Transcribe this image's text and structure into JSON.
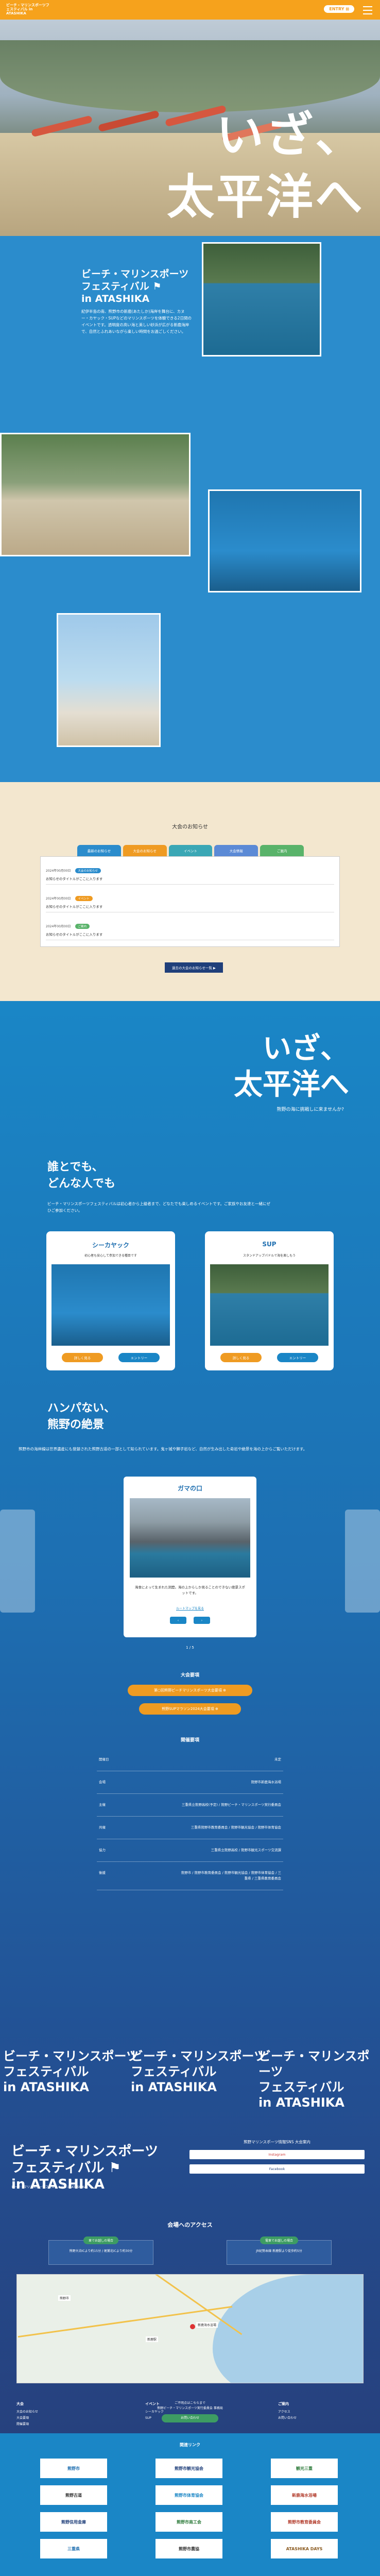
{
  "header": {
    "logo_text": "ビーチ・マリンスポーツフェスティバル in ATASHIKA",
    "entry_label": "ENTRY ⊠",
    "brand_color": "#f6a21c"
  },
  "hero": {
    "title_line1": "いざ、",
    "title_line2": "太平洋へ"
  },
  "intro": {
    "title_line1": "ビーチ・マリンスポーツ",
    "title_line2": "フェスティバル",
    "title_line3": "in ATASHIKA",
    "body": "紀伊半島の南、熊野市の新鹿(あたしか)海岸を舞台に、カヌー・カヤック・SUPなどのマリンスポーツを体験できる2日間のイベントです。透明度の高い海と美しい砂浜が広がる新鹿海岸で、自然とふれあいながら楽しい時間をお過ごしください。"
  },
  "news": {
    "title": "大会のお知らせ",
    "tabs": [
      "最新のお知らせ",
      "大会のお知らせ",
      "イベント",
      "大会情報",
      "ご案内"
    ],
    "tab_colors": [
      "#2b8ccc",
      "#ef9b22",
      "#3aa7b5",
      "#5b8ad6",
      "#59b36a"
    ],
    "items": [
      {
        "date": "2024年00月00日",
        "tag": "大会のお知らせ",
        "tag_color": "#2b8ccc",
        "text": "お知らせのタイトルがここに入ります"
      },
      {
        "date": "2024年00月00日",
        "tag": "イベント",
        "tag_color": "#ef9b22",
        "text": "お知らせのタイトルがここに入ります"
      },
      {
        "date": "2024年00月00日",
        "tag": "ご案内",
        "tag_color": "#59b36a",
        "text": "お知らせのタイトルがここに入ります"
      }
    ],
    "more_label": "過去の大会のお知らせ一覧 ▶"
  },
  "catch": {
    "line1": "いざ、",
    "line2": "太平洋へ",
    "sub": "熊野の海に挑戦しに来ませんか?"
  },
  "everyone": {
    "title_line1": "誰とでも、",
    "title_line2": "どんな人でも",
    "body": "ビーチ・マリンスポーツフェスティバルは初心者から上級者まで、どなたでも楽しめるイベントです。ご家族やお友達と一緒にぜひご参加ください。"
  },
  "cards": [
    {
      "title": "シーカヤック",
      "sub": "初心者も安心して参加できる種目です",
      "btn1": "詳しく見る",
      "btn2": "エントリー"
    },
    {
      "title": "SUP",
      "sub": "スタンドアップパドルで海を楽しもう",
      "btn1": "詳しく見る",
      "btn2": "エントリー"
    }
  ],
  "scenery": {
    "title_line1": "ハンパない、",
    "title_line2": "熊野の絶景",
    "body": "熊野市の海岸線は世界遺産にも登録された熊野古道の一部として知られています。鬼ヶ城や獅子岩など、自然が生み出した奇岩や絶景を海の上からご覧いただけます。"
  },
  "slide": {
    "title": "ガマの口",
    "desc": "海食によって生まれた洞窟。海の上からしか見ることのできない絶景スポットです。",
    "link": "ルートマップを見る",
    "prev": "‹",
    "next": "›",
    "counter": "1 / 5"
  },
  "rules": {
    "title": "大会要項",
    "btn1": "第○回熊野ビーチマリンスポーツ大会要項 ⊕",
    "btn2": "熊野SUPマラソン2024大会要項 ⊕"
  },
  "org": {
    "title": "開催要項",
    "rows": [
      {
        "k": "開催日",
        "v": "未定"
      },
      {
        "k": "会場",
        "v": "熊野市新鹿海水浴場"
      },
      {
        "k": "主催",
        "v": "三重県立熊野高校(予定) / 熊野ビーチ・マリンスポーツ実行委員会"
      },
      {
        "k": "共催",
        "v": "三重県熊野市教育委員会 / 熊野市観光協会 / 熊野市体育協会"
      },
      {
        "k": "協力",
        "v": "三重県立熊野高校 / 熊野市観光スポーツ交流課"
      },
      {
        "k": "後援",
        "v": "熊野市 / 熊野市教育委員会 / 熊野市観光協会 / 熊野市体育協会 / 三重県 / 三重県教育委員会"
      }
    ]
  },
  "marquee": {
    "line1": "ビーチ・マリンスポーツ",
    "line2": "フェスティバル",
    "line3": "in ATASHIKA"
  },
  "footer": {
    "logo_line1": "ビーチ・マリンスポーツ",
    "logo_line2": "フェスティバル",
    "logo_line3": "in ATASHIKA",
    "logo_sub": "ビーチ・マリンスポーツフェスティバル in ATASHIKA",
    "entry_title": "熊野マリンスポーツ情報SNS 大会案内",
    "entry_btn1": "Instagram",
    "entry_btn2": "Facebook",
    "access_title": "会場へのアクセス",
    "access_boxes": [
      {
        "badge": "車でお越しの場合",
        "text": "熊野大泊ICより約15分 / 尾鷲北ICより約30分"
      },
      {
        "badge": "電車でお越しの場合",
        "text": "JR紀勢本線 新鹿駅より徒歩約5分"
      }
    ],
    "map_labels": [
      "新鹿海水浴場",
      "新鹿駅",
      "熊野市"
    ],
    "sitemap": [
      {
        "head": "大会",
        "items": [
          "大会のお知らせ",
          "大会要項",
          "開催要項"
        ]
      },
      {
        "head": "イベント",
        "items": [
          "シーカヤック",
          "SUP"
        ]
      },
      {
        "head": "ご案内",
        "items": [
          "アクセス",
          "お問い合わせ"
        ]
      }
    ],
    "contact_head": "ご不明点はこちらまで",
    "contact_text": "熊野ビーチ・マリンスポーツ実行委員会 事務局",
    "contact_btn": "お問い合わせ"
  },
  "sponsors": {
    "title": "関連リンク",
    "items": [
      "熊野市",
      "熊野市観光協会",
      "観光三重",
      "熊野古道",
      "熊野市体育協会",
      "新鹿海水浴場",
      "熊野信用金庫",
      "熊野市商工会",
      "熊野市教育委員会",
      "三重県",
      "熊野市農協",
      "ATASHIKA DAYS"
    ]
  }
}
